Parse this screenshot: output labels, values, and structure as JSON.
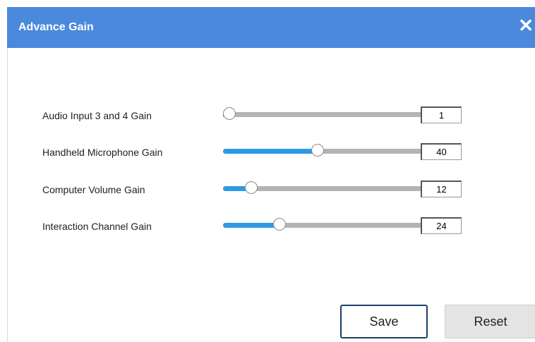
{
  "dialog": {
    "title": "Advance Gain",
    "close_label": "✕"
  },
  "gains": [
    {
      "label": "Audio Input 3 and 4 Gain",
      "value": "1",
      "level": 1
    },
    {
      "label": "Handheld Microphone Gain",
      "value": "40",
      "level": 40
    },
    {
      "label": "Computer Volume Gain",
      "value": "12",
      "level": 12
    },
    {
      "label": "Interaction Channel Gain",
      "value": "24",
      "level": 24
    }
  ],
  "slider_max": 100,
  "buttons": {
    "save": "Save",
    "reset": "Reset"
  },
  "colors": {
    "header": "#4a89dc",
    "slider_fill": "#2c9ae8",
    "slider_track": "#b4b4b4"
  }
}
